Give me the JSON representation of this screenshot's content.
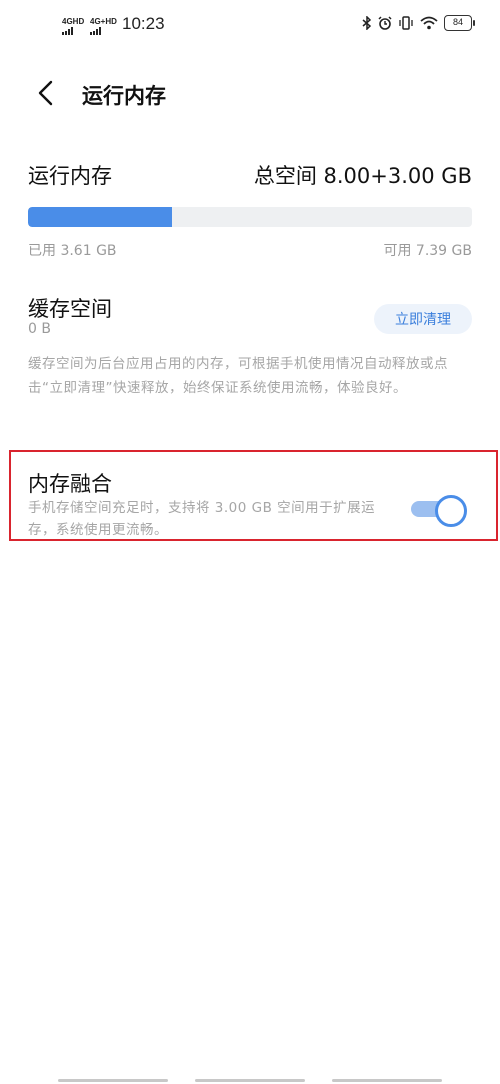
{
  "status_bar": {
    "sim1_label": "4GHD",
    "sim2_label": "4G+HD",
    "time": "10:23",
    "battery": "84",
    "icons": [
      "bluetooth-icon",
      "alarm-icon",
      "vibrate-icon",
      "wifi-icon",
      "battery-icon"
    ]
  },
  "header": {
    "title": "运行内存",
    "back_icon": "chevron-left-icon"
  },
  "memory": {
    "label": "运行内存",
    "total": "总空间 8.00+3.00 GB",
    "used": "已用 3.61 GB",
    "available": "可用 7.39 GB",
    "used_fraction": 0.325,
    "bar_color": "#4a8de8",
    "track_color": "#eef0f2"
  },
  "cache": {
    "title": "缓存空间",
    "size": "0 B",
    "clean_button": "立即清理",
    "description": "缓存空间为后台应用占用的内存，可根据手机使用情况自动释放或点击“立即清理”快速释放，始终保证系统使用流畅，体验良好。"
  },
  "fusion": {
    "title": "内存融合",
    "description": "手机存储空间充足时，支持将 3.00 GB 空间用于扩展运存，系统使用更流畅。",
    "toggle_on": true,
    "highlight_color": "#d9242e"
  }
}
